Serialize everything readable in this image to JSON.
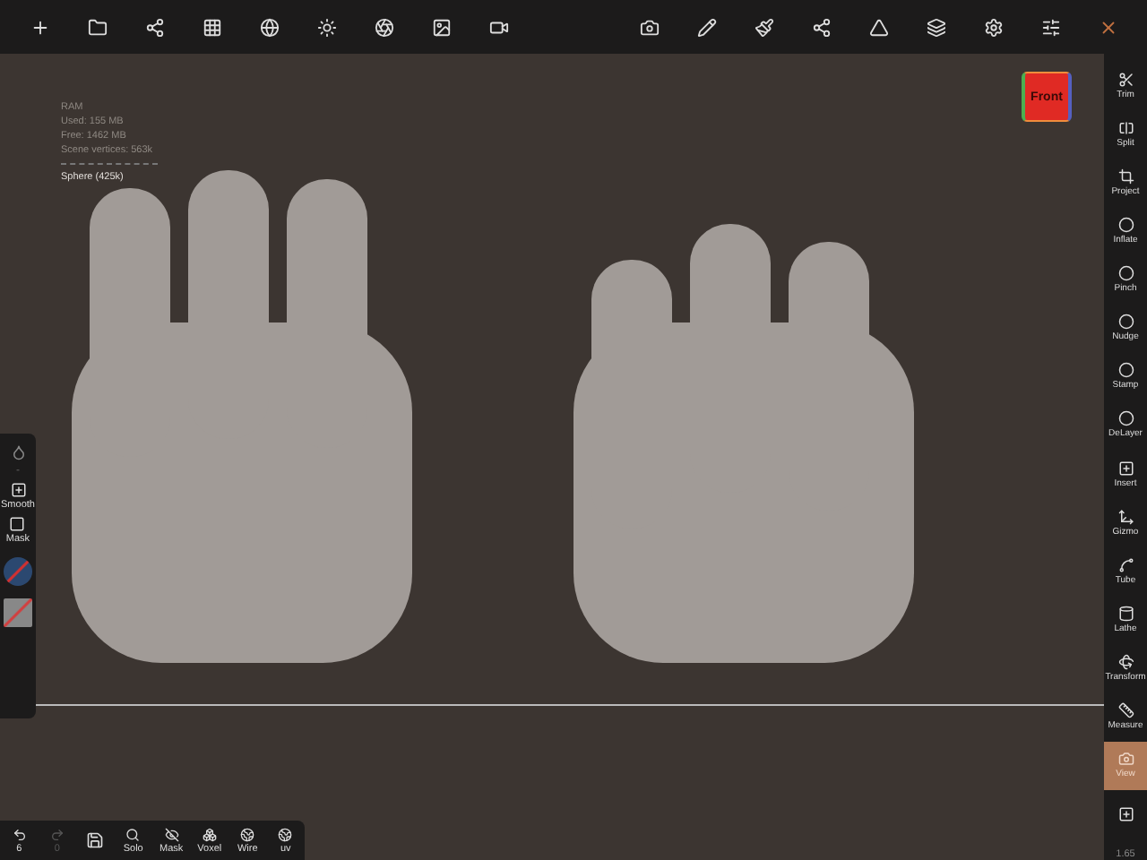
{
  "stats": {
    "lines": [
      "RAM",
      "Used: 155 MB",
      "Free: 1462 MB",
      "Scene vertices: 563k"
    ],
    "object": "Sphere (425k)"
  },
  "view_cube": {
    "label": "Front"
  },
  "tools": [
    {
      "label": "Trim",
      "selected": false
    },
    {
      "label": "Split",
      "selected": false
    },
    {
      "label": "Project",
      "selected": false
    },
    {
      "label": "Inflate",
      "selected": false
    },
    {
      "label": "Pinch",
      "selected": false
    },
    {
      "label": "Nudge",
      "selected": false
    },
    {
      "label": "Stamp",
      "selected": false
    },
    {
      "label": "DeLayer",
      "selected": false
    },
    {
      "label": "Insert",
      "selected": false
    },
    {
      "label": "Gizmo",
      "selected": false
    },
    {
      "label": "Tube",
      "selected": false
    },
    {
      "label": "Lathe",
      "selected": false
    },
    {
      "label": "Transform",
      "selected": false
    },
    {
      "label": "Measure",
      "selected": false
    },
    {
      "label": "View",
      "selected": true
    }
  ],
  "zoom_reading": "1.65",
  "left_panel": {
    "items": [
      {
        "kind": "action",
        "label": "Smooth"
      },
      {
        "kind": "action",
        "label": "Mask"
      }
    ],
    "divider": "-"
  },
  "bottom_bar": {
    "undo": {
      "count": "6",
      "disabled": false
    },
    "redo": {
      "count": "0",
      "disabled": true
    },
    "items": [
      {
        "kind": "toggle",
        "label": "Solo"
      },
      {
        "kind": "toggle",
        "label": "Mask"
      },
      {
        "kind": "toggle",
        "label": "Voxel"
      },
      {
        "kind": "toggle",
        "label": "Wire"
      },
      {
        "kind": "toggle",
        "label": "uv"
      }
    ]
  }
}
